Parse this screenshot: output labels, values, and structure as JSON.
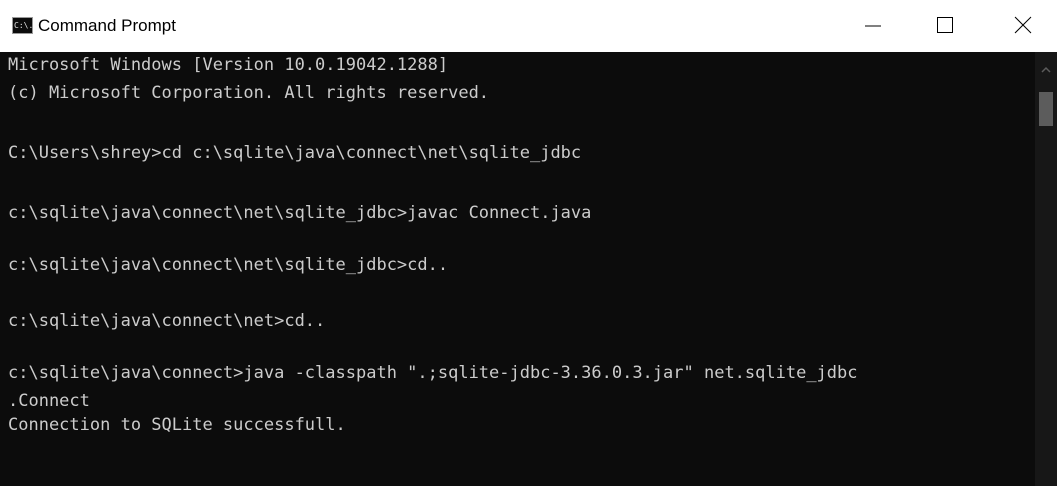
{
  "window": {
    "title": "Command Prompt",
    "icon_text": "C:\\."
  },
  "icons": {
    "app": "cmd-icon",
    "minimize": "minimize-icon",
    "maximize": "maximize-icon",
    "close": "close-icon",
    "scroll_up": "chevron-up-icon"
  },
  "terminal": {
    "lines": [
      "Microsoft Windows [Version 10.0.19042.1288]",
      "(c) Microsoft Corporation. All rights reserved.",
      "",
      "C:\\Users\\shrey>cd c:\\sqlite\\java\\connect\\net\\sqlite_jdbc",
      "",
      "c:\\sqlite\\java\\connect\\net\\sqlite_jdbc>javac Connect.java",
      "",
      "c:\\sqlite\\java\\connect\\net\\sqlite_jdbc>cd..",
      "",
      "c:\\sqlite\\java\\connect\\net>cd..",
      "",
      "c:\\sqlite\\java\\connect>java -classpath \".;sqlite-jdbc-3.36.0.3.jar\" net.sqlite_jdbc",
      ".Connect",
      "Connection to SQLite successfull."
    ]
  },
  "colors": {
    "background": "#0c0c0c",
    "text": "#cccccc",
    "titlebar": "#ffffff"
  }
}
